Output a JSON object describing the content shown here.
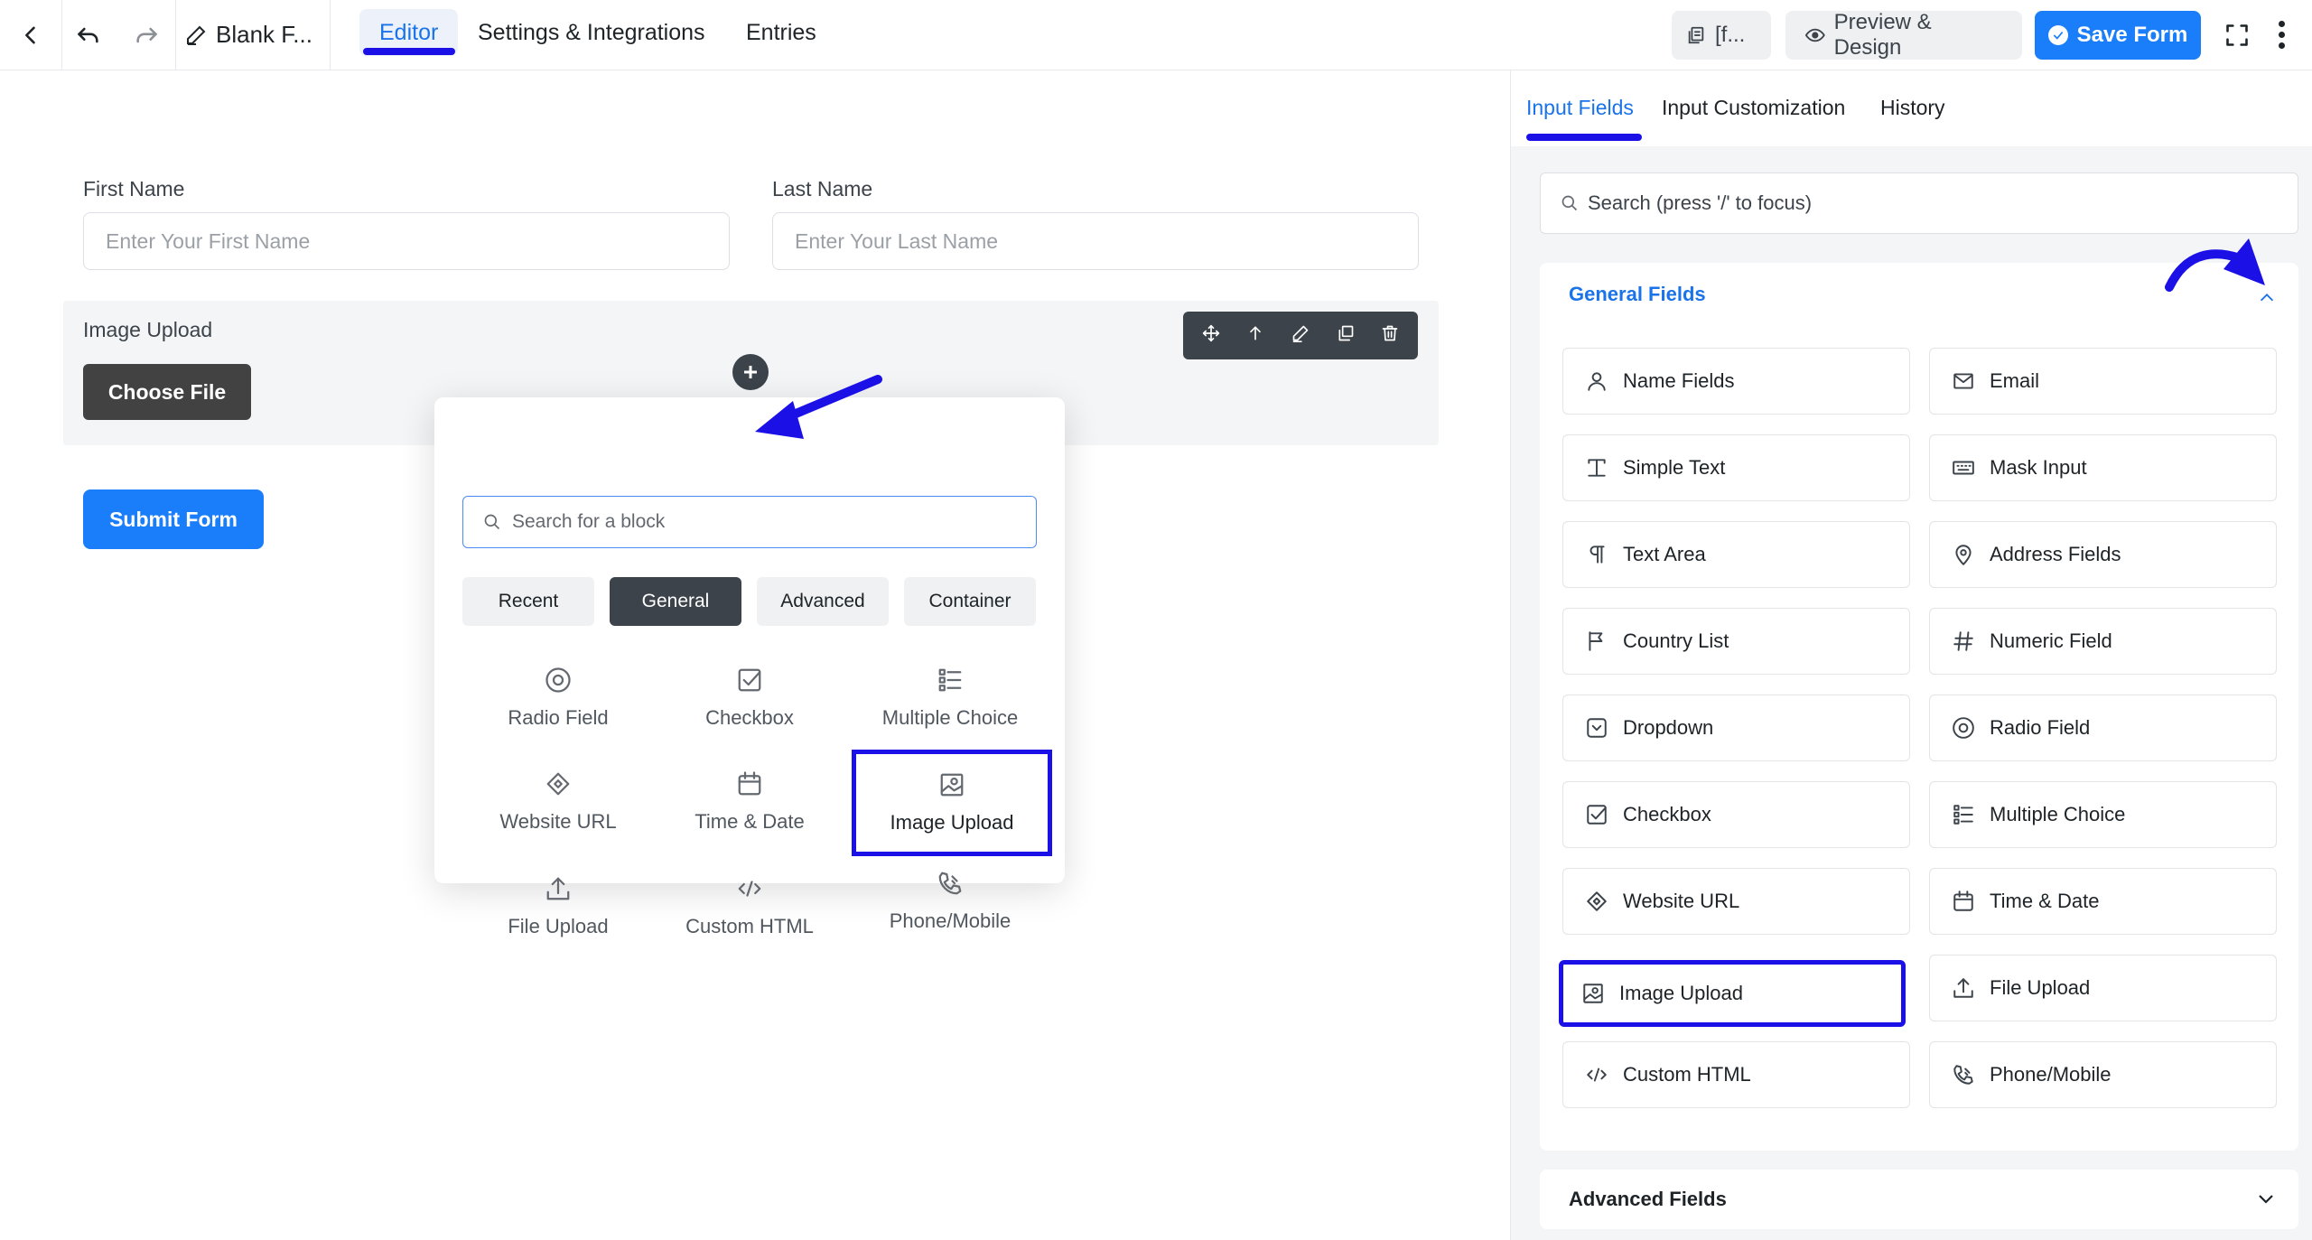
{
  "topbar": {
    "form_title": "Blank F...",
    "tabs": [
      {
        "label": "Editor",
        "active": true
      },
      {
        "label": "Settings & Integrations",
        "active": false
      },
      {
        "label": "Entries",
        "active": false
      }
    ],
    "shortcode_label": "[f...",
    "preview_label": "Preview & Design",
    "save_label": "Save Form"
  },
  "form": {
    "first_name": {
      "label": "First Name",
      "placeholder": "Enter Your First Name"
    },
    "last_name": {
      "label": "Last Name",
      "placeholder": "Enter Your Last Name"
    },
    "image_upload": {
      "label": "Image Upload",
      "button": "Choose File"
    },
    "submit_label": "Submit Form"
  },
  "popover": {
    "search_placeholder": "Search for a block",
    "tabs": [
      {
        "label": "Recent",
        "active": false
      },
      {
        "label": "General",
        "active": true
      },
      {
        "label": "Advanced",
        "active": false
      },
      {
        "label": "Container",
        "active": false
      }
    ],
    "items": [
      {
        "label": "Radio Field",
        "icon": "radio-icon"
      },
      {
        "label": "Checkbox",
        "icon": "checkbox-icon"
      },
      {
        "label": "Multiple Choice",
        "icon": "list-icon"
      },
      {
        "label": "Website URL",
        "icon": "link-icon"
      },
      {
        "label": "Time & Date",
        "icon": "calendar-icon"
      },
      {
        "label": "Image Upload",
        "icon": "image-icon",
        "highlighted": true
      },
      {
        "label": "File Upload",
        "icon": "upload-icon"
      },
      {
        "label": "Custom HTML",
        "icon": "code-icon"
      },
      {
        "label": "Phone/Mobile",
        "icon": "phone-icon"
      }
    ]
  },
  "panel": {
    "tabs": [
      {
        "label": "Input Fields",
        "active": true
      },
      {
        "label": "Input Customization",
        "active": false
      },
      {
        "label": "History",
        "active": false
      }
    ],
    "search_placeholder": "Search (press '/' to focus)",
    "general_title": "General Fields",
    "advanced_title": "Advanced Fields",
    "fields": [
      {
        "label": "Name Fields",
        "icon": "user-icon"
      },
      {
        "label": "Email",
        "icon": "envelope-icon"
      },
      {
        "label": "Simple Text",
        "icon": "text-icon"
      },
      {
        "label": "Mask Input",
        "icon": "keyboard-icon"
      },
      {
        "label": "Text Area",
        "icon": "paragraph-icon"
      },
      {
        "label": "Address Fields",
        "icon": "map-pin-icon"
      },
      {
        "label": "Country List",
        "icon": "flag-icon"
      },
      {
        "label": "Numeric Field",
        "icon": "hash-icon"
      },
      {
        "label": "Dropdown",
        "icon": "dropdown-icon"
      },
      {
        "label": "Radio Field",
        "icon": "radio-icon"
      },
      {
        "label": "Checkbox",
        "icon": "checkbox-icon"
      },
      {
        "label": "Multiple Choice",
        "icon": "list-icon"
      },
      {
        "label": "Website URL",
        "icon": "link-icon"
      },
      {
        "label": "Time & Date",
        "icon": "calendar-icon"
      },
      {
        "label": "Image Upload",
        "icon": "image-icon",
        "highlighted": true
      },
      {
        "label": "File Upload",
        "icon": "upload-icon"
      },
      {
        "label": "Custom HTML",
        "icon": "code-icon"
      },
      {
        "label": "Phone/Mobile",
        "icon": "phone-icon"
      }
    ]
  },
  "colors": {
    "accent": "#1a7efb",
    "highlight": "#1b10e6",
    "dark": "#3c434a"
  }
}
